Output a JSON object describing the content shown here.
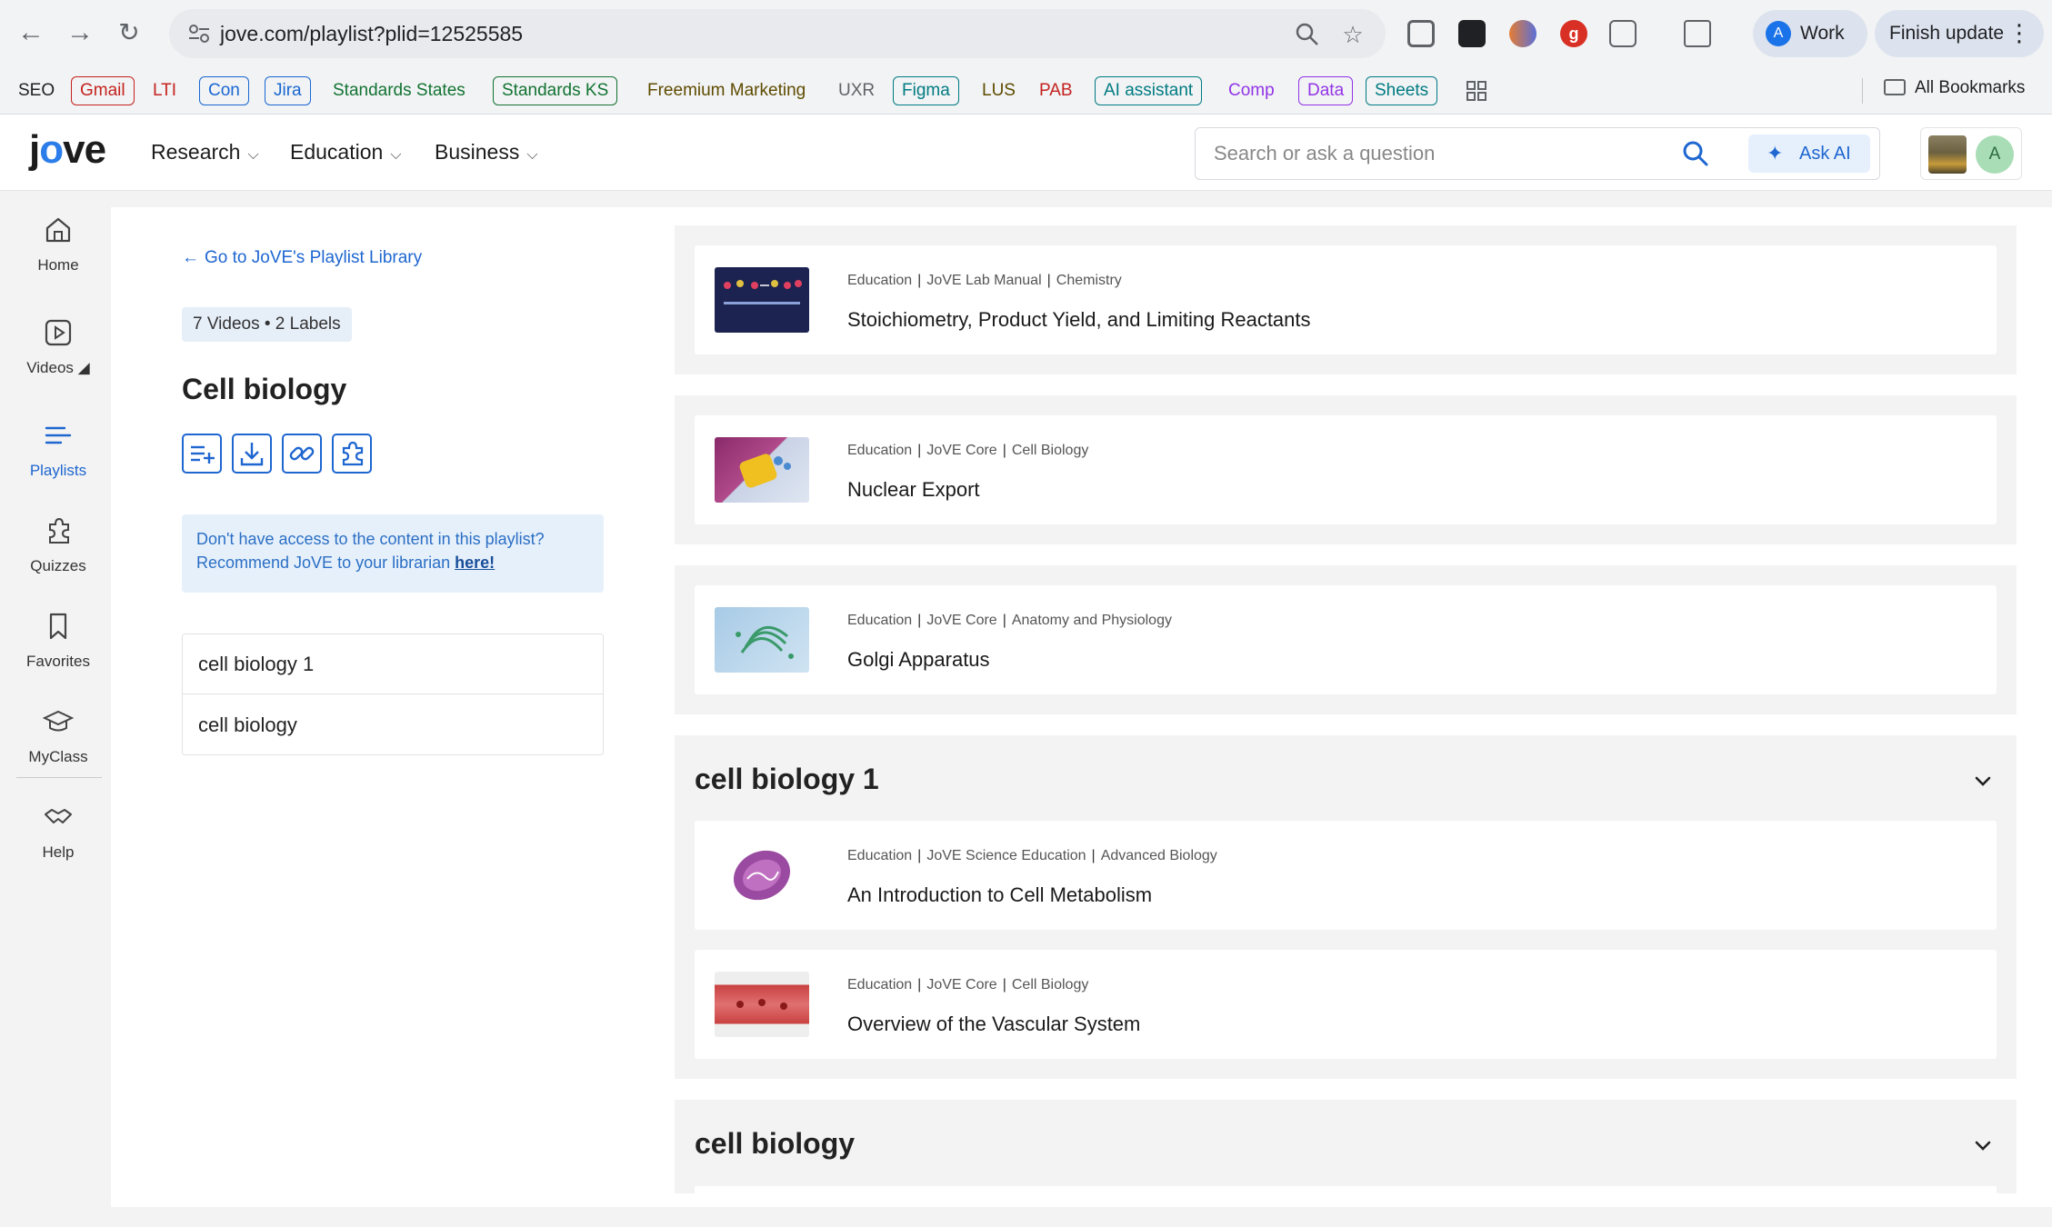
{
  "browser": {
    "url": "jove.com/playlist?plid=12525585",
    "profile_label": "Work",
    "profile_initial": "A",
    "update_label": "Finish update",
    "bookmarks": [
      {
        "label": "SEO",
        "color": "#202124",
        "border": "transparent"
      },
      {
        "label": "Gmail",
        "color": "#c5221f",
        "border": "#c5221f"
      },
      {
        "label": "LTI",
        "color": "#c5221f",
        "border": "transparent"
      },
      {
        "label": "Con",
        "color": "#1967d2",
        "border": "#1967d2"
      },
      {
        "label": "Jira",
        "color": "#1967d2",
        "border": "#1967d2"
      },
      {
        "label": "Standards States",
        "color": "#137333",
        "border": "transparent"
      },
      {
        "label": "Standards KS",
        "color": "#137333",
        "border": "#137333"
      },
      {
        "label": "Freemium Marketing",
        "color": "#5f4b00",
        "border": "transparent"
      },
      {
        "label": "UXR",
        "color": "#5f6368",
        "border": "transparent"
      },
      {
        "label": "Figma",
        "color": "#007b83",
        "border": "#007b83"
      },
      {
        "label": "LUS",
        "color": "#5f4b00",
        "border": "transparent"
      },
      {
        "label": "PAB",
        "color": "#c5221f",
        "border": "transparent"
      },
      {
        "label": "AI assistant",
        "color": "#007b83",
        "border": "#007b83"
      },
      {
        "label": "Comp",
        "color": "#9334e6",
        "border": "transparent"
      },
      {
        "label": "Data",
        "color": "#9334e6",
        "border": "#9334e6"
      },
      {
        "label": "Sheets",
        "color": "#007b83",
        "border": "#007b83"
      }
    ],
    "all_bookmarks": "All Bookmarks"
  },
  "header": {
    "logo_left": "j",
    "logo_o": "o",
    "logo_right": "ve",
    "nav": [
      "Research",
      "Education",
      "Business"
    ],
    "search_placeholder": "Search or ask a question",
    "ask_ai": "Ask AI",
    "avatar_initial": "A"
  },
  "sidebar": {
    "items": [
      {
        "label": "Home",
        "icon": "home-icon"
      },
      {
        "label": "Videos ◢",
        "icon": "video-icon"
      },
      {
        "label": "Playlists",
        "icon": "playlist-icon",
        "active": true
      },
      {
        "label": "Quizzes",
        "icon": "puzzle-icon"
      },
      {
        "label": "Favorites",
        "icon": "bookmark-icon"
      },
      {
        "label": "MyClass",
        "icon": "graduation-cap-icon"
      },
      {
        "label": "Help",
        "icon": "handshake-icon"
      }
    ]
  },
  "playlist": {
    "back_link": "Go to JoVE's Playlist Library",
    "count": "7 Videos • 2 Labels",
    "title": "Cell biology",
    "info_line1": "Don't have access to the content in this playlist?",
    "info_line2": "Recommend JoVE to your librarian",
    "info_link": "here!",
    "labels": [
      "cell biology 1",
      "cell biology"
    ]
  },
  "videos": {
    "ungrouped": [
      {
        "meta": [
          "Education",
          "JoVE Lab Manual",
          "Chemistry"
        ],
        "title": "Stoichiometry, Product Yield, and Limiting Reactants"
      },
      {
        "meta": [
          "Education",
          "JoVE Core",
          "Cell Biology"
        ],
        "title": "Nuclear Export"
      },
      {
        "meta": [
          "Education",
          "JoVE Core",
          "Anatomy and Physiology"
        ],
        "title": "Golgi Apparatus"
      }
    ],
    "groups": [
      {
        "name": "cell biology 1",
        "items": [
          {
            "meta": [
              "Education",
              "JoVE Science Education",
              "Advanced Biology"
            ],
            "title": "An Introduction to Cell Metabolism"
          },
          {
            "meta": [
              "Education",
              "JoVE Core",
              "Cell Biology"
            ],
            "title": "Overview of the Vascular System"
          }
        ]
      },
      {
        "name": "cell biology",
        "items": []
      }
    ]
  },
  "colors": {
    "accent": "#1e66d0",
    "panel": "#f3f3f3"
  }
}
